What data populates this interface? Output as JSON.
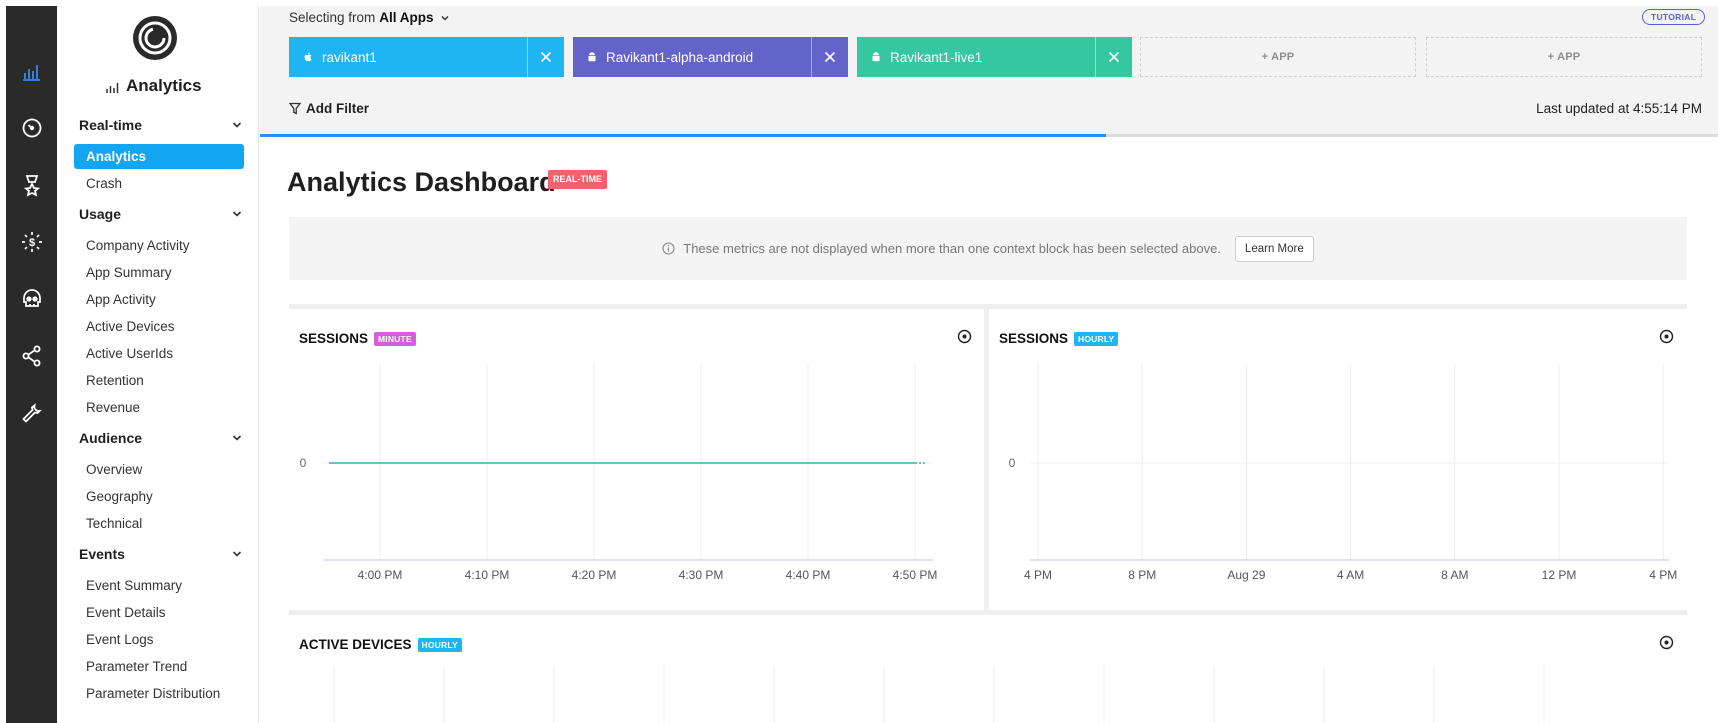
{
  "rail": [
    {
      "name": "analytics-icon",
      "color": "#2f8dec",
      "active": true
    },
    {
      "name": "gauge-icon",
      "color": "#ffffff"
    },
    {
      "name": "badge-icon",
      "color": "#ffffff"
    },
    {
      "name": "revenue-icon",
      "color": "#ffffff"
    },
    {
      "name": "skull-icon",
      "color": "#ffffff"
    },
    {
      "name": "share-icon",
      "color": "#ffffff"
    },
    {
      "name": "wrench-icon",
      "color": "#ffffff"
    }
  ],
  "brand": {
    "title": "Analytics",
    "logo_icon": "countly-logo"
  },
  "nav": {
    "sections": [
      {
        "label": "Real-time",
        "items": [
          {
            "label": "Analytics",
            "active": true
          },
          {
            "label": "Crash"
          }
        ]
      },
      {
        "label": "Usage",
        "items": [
          {
            "label": "Company Activity"
          },
          {
            "label": "App Summary"
          },
          {
            "label": "App Activity"
          },
          {
            "label": "Active Devices"
          },
          {
            "label": "Active UserIds"
          },
          {
            "label": "Retention"
          },
          {
            "label": "Revenue"
          }
        ]
      },
      {
        "label": "Audience",
        "items": [
          {
            "label": "Overview"
          },
          {
            "label": "Geography"
          },
          {
            "label": "Technical"
          }
        ]
      },
      {
        "label": "Events",
        "items": [
          {
            "label": "Event Summary"
          },
          {
            "label": "Event Details"
          },
          {
            "label": "Event Logs"
          },
          {
            "label": "Parameter Trend"
          },
          {
            "label": "Parameter Distribution"
          }
        ]
      }
    ]
  },
  "header": {
    "selecting_prefix": "Selecting from",
    "selecting_value": "All Apps",
    "tutorial": "TUTORIAL",
    "apps": [
      {
        "label": "ravikant1",
        "platform_icon": "apple-icon",
        "color": "#1fb5f2"
      },
      {
        "label": "Ravikant1-alpha-android",
        "platform_icon": "android-icon",
        "color": "#6463c9"
      },
      {
        "label": "Ravikant1-live1",
        "platform_icon": "android-icon",
        "color": "#35c7a0"
      }
    ],
    "add_app": "+ APP",
    "add_filter": "Add Filter",
    "last_updated": "Last updated at 4:55:14 PM"
  },
  "progress": 0.58,
  "dashboard": {
    "title": "Analytics Dashboard",
    "badge": "REAL-TIME",
    "badge_color": "#f0626c",
    "notice": "These metrics are not displayed when more than one context block has been selected above.",
    "learn_more": "Learn More"
  },
  "panels": {
    "sessions_minute": {
      "title": "SESSIONS",
      "badge": "MINUTE",
      "badge_color": "#d65ed8"
    },
    "sessions_hourly": {
      "title": "SESSIONS",
      "badge": "HOURLY",
      "badge_color": "#1fb5f2"
    },
    "active_devices": {
      "title": "ACTIVE DEVICES",
      "badge": "HOURLY",
      "badge_color": "#1fb5f2"
    }
  },
  "chart_data": [
    {
      "type": "line",
      "title": "SESSIONS",
      "x": [
        "4:00 PM",
        "4:10 PM",
        "4:20 PM",
        "4:30 PM",
        "4:40 PM",
        "4:50 PM"
      ],
      "series": [
        {
          "values": [
            0,
            0,
            0,
            0,
            0,
            0
          ],
          "color": "#35b39a"
        }
      ],
      "y_ticks": [
        "0"
      ],
      "grid": true
    },
    {
      "type": "line",
      "title": "SESSIONS",
      "x": [
        "4 PM",
        "8 PM",
        "Aug 29",
        "4 AM",
        "8 AM",
        "12 PM",
        "4 PM"
      ],
      "series": [],
      "y_ticks": [
        "0"
      ],
      "grid": true
    }
  ]
}
